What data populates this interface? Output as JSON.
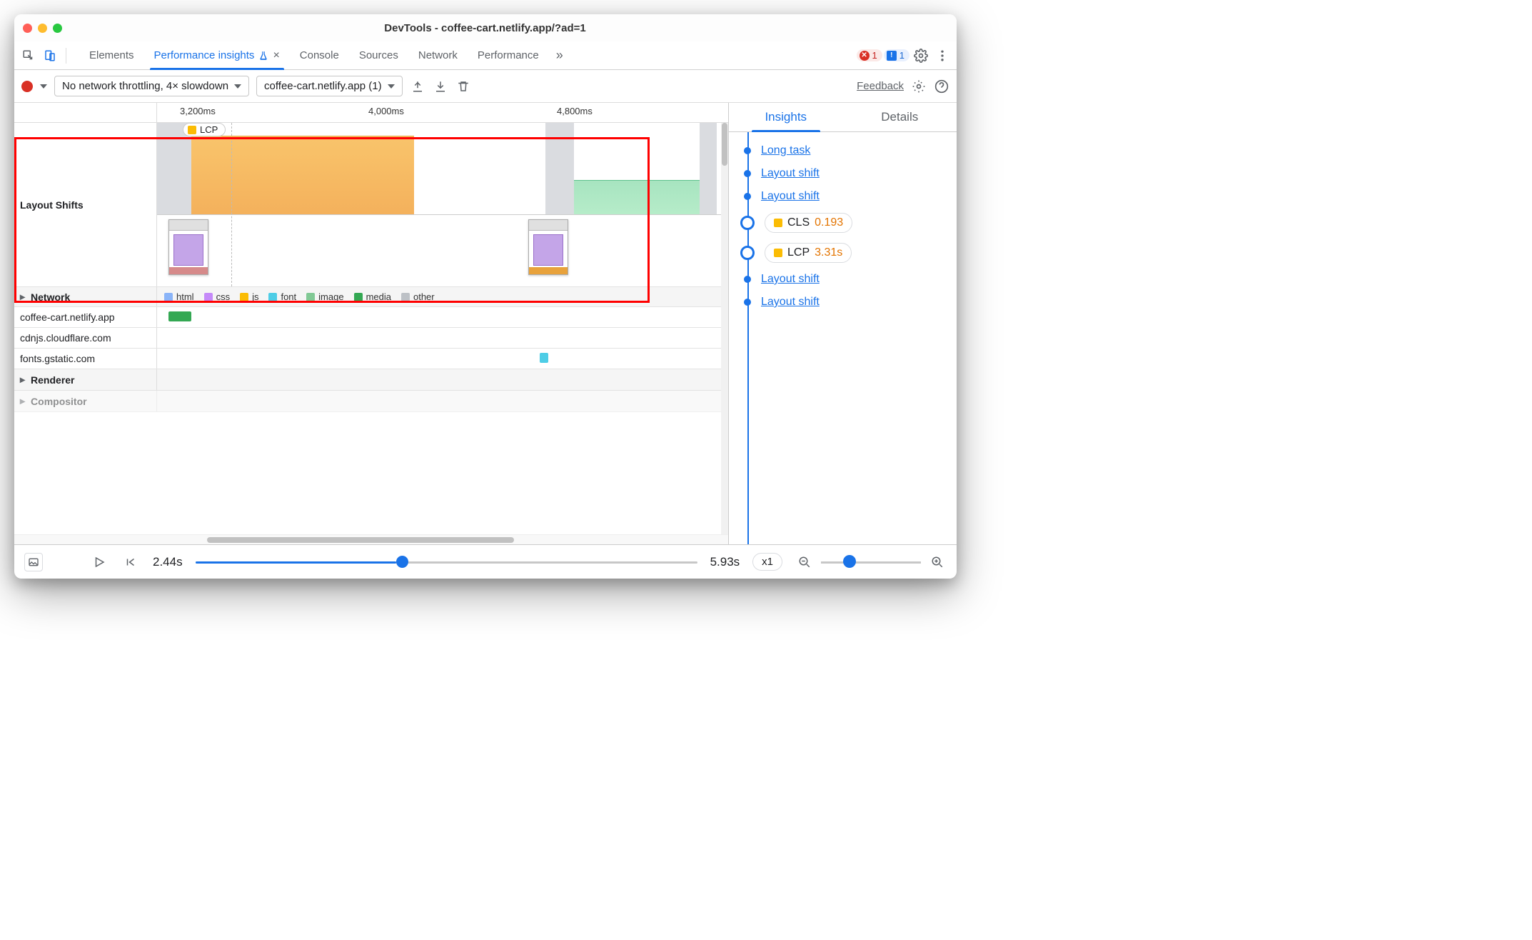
{
  "window_title": "DevTools - coffee-cart.netlify.app/?ad=1",
  "tabs": [
    "Elements",
    "Performance insights",
    "Console",
    "Sources",
    "Network",
    "Performance"
  ],
  "selected_tab_index": 1,
  "error_badge_count": "1",
  "issue_badge_count": "1",
  "toolbar": {
    "throttle": "No network throttling, 4× slowdown",
    "recording_select": "coffee-cart.netlify.app (1)",
    "feedback": "Feedback"
  },
  "ruler": {
    "ticks": [
      {
        "label": "3,200ms",
        "left_pct": 4
      },
      {
        "label": "4,000ms",
        "left_pct": 37
      },
      {
        "label": "4,800ms",
        "left_pct": 70
      }
    ],
    "lcp_chip": "LCP"
  },
  "layout_shifts_label": "Layout Shifts",
  "network_section": "Network",
  "network_legend": [
    {
      "key": "html",
      "label": "html"
    },
    {
      "key": "css",
      "label": "css"
    },
    {
      "key": "js",
      "label": "js"
    },
    {
      "key": "font",
      "label": "font"
    },
    {
      "key": "image",
      "label": "image"
    },
    {
      "key": "media",
      "label": "media"
    },
    {
      "key": "other",
      "label": "other"
    }
  ],
  "network_rows": [
    {
      "host": "coffee-cart.netlify.app",
      "bar": {
        "type": "image",
        "left_pct": 2,
        "width_pct": 4
      }
    },
    {
      "host": "cdnjs.cloudflare.com",
      "bar": null
    },
    {
      "host": "fonts.gstatic.com",
      "bar": {
        "type": "font",
        "left_pct": 67,
        "width_pct": 1.5
      }
    }
  ],
  "renderer_section": "Renderer",
  "compositor_section": "Compositor",
  "sidebar_tabs": [
    "Insights",
    "Details"
  ],
  "sidebar_selected_index": 0,
  "insights": [
    {
      "type": "link",
      "label": "Long task"
    },
    {
      "type": "link",
      "label": "Layout shift"
    },
    {
      "type": "link",
      "label": "Layout shift"
    },
    {
      "type": "chip",
      "metric": "CLS",
      "value": "0.193",
      "sw": "orange",
      "big": true
    },
    {
      "type": "chip",
      "metric": "LCP",
      "value": "3.31s",
      "sw": "orange",
      "big": true
    },
    {
      "type": "link",
      "label": "Layout shift"
    },
    {
      "type": "link",
      "label": "Layout shift"
    }
  ],
  "footer": {
    "start_time": "2.44s",
    "end_time": "5.93s",
    "rate": "x1"
  }
}
